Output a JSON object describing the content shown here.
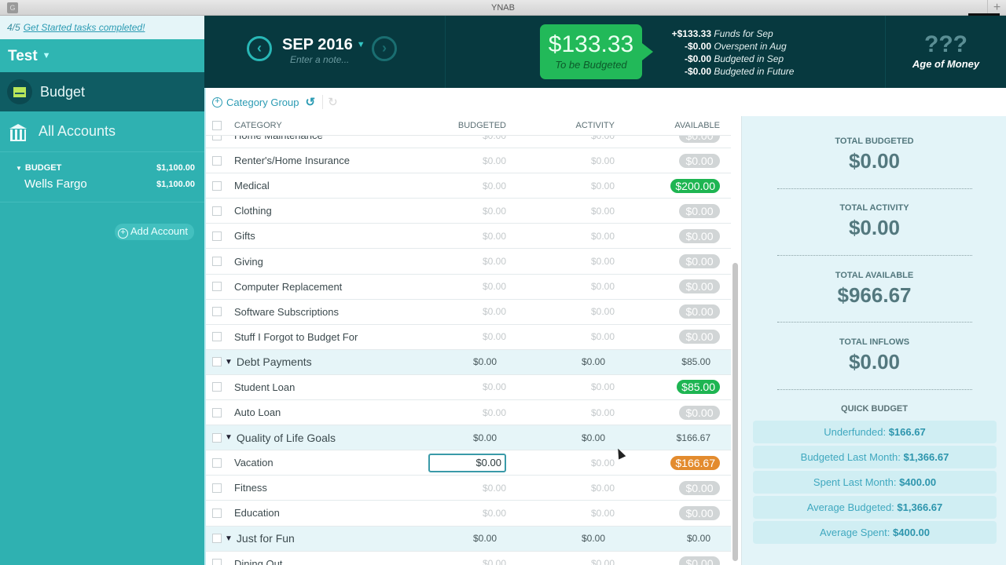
{
  "window": {
    "title": "YNAB"
  },
  "sidebar": {
    "get_started": {
      "count": "4/5",
      "link": "Get Started tasks completed!"
    },
    "budget_name": "Test",
    "nav": [
      {
        "label": "Budget",
        "icon": "envelope-icon"
      },
      {
        "label": "All Accounts",
        "icon": "bank-icon"
      }
    ],
    "account_group": {
      "label": "BUDGET",
      "total": "$1,100.00"
    },
    "accounts": [
      {
        "name": "Wells Fargo",
        "balance": "$1,100.00"
      }
    ],
    "add_account": "Add Account"
  },
  "header": {
    "month": "SEP 2016",
    "note_placeholder": "Enter a note...",
    "to_be_budgeted": {
      "amount": "$133.33",
      "label": "To be Budgeted",
      "color": "#22b959"
    },
    "breakdown": [
      {
        "value": "+$133.33",
        "label": "Funds for Sep"
      },
      {
        "value": "-$0.00",
        "label": "Overspent in Aug"
      },
      {
        "value": "-$0.00",
        "label": "Budgeted in Sep"
      },
      {
        "value": "-$0.00",
        "label": "Budgeted in Future"
      }
    ],
    "age_of_money": {
      "value": "???",
      "label": "Age of Money"
    }
  },
  "toolbar": {
    "category_group": "Category Group"
  },
  "table": {
    "columns": [
      "CATEGORY",
      "BUDGETED",
      "ACTIVITY",
      "AVAILABLE"
    ],
    "partial_row": {
      "name": "Home Maintenance",
      "budgeted": "$0.00",
      "activity": "$0.00",
      "available": "$0.00"
    },
    "rows": [
      {
        "type": "cat",
        "name": "Renter's/Home Insurance",
        "budgeted": "$0.00",
        "activity": "$0.00",
        "available": "$0.00",
        "status": "zero"
      },
      {
        "type": "cat",
        "name": "Medical",
        "budgeted": "$0.00",
        "activity": "$0.00",
        "available": "$200.00",
        "status": "green"
      },
      {
        "type": "cat",
        "name": "Clothing",
        "budgeted": "$0.00",
        "activity": "$0.00",
        "available": "$0.00",
        "status": "zero"
      },
      {
        "type": "cat",
        "name": "Gifts",
        "budgeted": "$0.00",
        "activity": "$0.00",
        "available": "$0.00",
        "status": "zero"
      },
      {
        "type": "cat",
        "name": "Giving",
        "budgeted": "$0.00",
        "activity": "$0.00",
        "available": "$0.00",
        "status": "zero"
      },
      {
        "type": "cat",
        "name": "Computer Replacement",
        "budgeted": "$0.00",
        "activity": "$0.00",
        "available": "$0.00",
        "status": "zero"
      },
      {
        "type": "cat",
        "name": "Software Subscriptions",
        "budgeted": "$0.00",
        "activity": "$0.00",
        "available": "$0.00",
        "status": "zero"
      },
      {
        "type": "cat",
        "name": "Stuff I Forgot to Budget For",
        "budgeted": "$0.00",
        "activity": "$0.00",
        "available": "$0.00",
        "status": "zero"
      },
      {
        "type": "group",
        "name": "Debt Payments",
        "budgeted": "$0.00",
        "activity": "$0.00",
        "available": "$85.00"
      },
      {
        "type": "cat",
        "name": "Student Loan",
        "budgeted": "$0.00",
        "activity": "$0.00",
        "available": "$85.00",
        "status": "green"
      },
      {
        "type": "cat",
        "name": "Auto Loan",
        "budgeted": "$0.00",
        "activity": "$0.00",
        "available": "$0.00",
        "status": "zero"
      },
      {
        "type": "group",
        "name": "Quality of Life Goals",
        "budgeted": "$0.00",
        "activity": "$0.00",
        "available": "$166.67"
      },
      {
        "type": "cat",
        "name": "Vacation",
        "budgeted": "$0.00",
        "activity": "$0.00",
        "available": "$166.67",
        "status": "orange",
        "editing": true
      },
      {
        "type": "cat",
        "name": "Fitness",
        "budgeted": "$0.00",
        "activity": "$0.00",
        "available": "$0.00",
        "status": "zero"
      },
      {
        "type": "cat",
        "name": "Education",
        "budgeted": "$0.00",
        "activity": "$0.00",
        "available": "$0.00",
        "status": "zero"
      },
      {
        "type": "group",
        "name": "Just for Fun",
        "budgeted": "$0.00",
        "activity": "$0.00",
        "available": "$0.00"
      },
      {
        "type": "cat",
        "name": "Dining Out",
        "budgeted": "$0.00",
        "activity": "$0.00",
        "available": "$0.00",
        "status": "zero"
      }
    ]
  },
  "inspector": {
    "totals": [
      {
        "label": "TOTAL BUDGETED",
        "value": "$0.00"
      },
      {
        "label": "TOTAL ACTIVITY",
        "value": "$0.00"
      },
      {
        "label": "TOTAL AVAILABLE",
        "value": "$966.67"
      },
      {
        "label": "TOTAL INFLOWS",
        "value": "$0.00"
      }
    ],
    "quick_budget_title": "QUICK BUDGET",
    "quick_budget": [
      {
        "label": "Underfunded:",
        "value": "$166.67"
      },
      {
        "label": "Budgeted Last Month:",
        "value": "$1,366.67"
      },
      {
        "label": "Spent Last Month:",
        "value": "$400.00"
      },
      {
        "label": "Average Budgeted:",
        "value": "$1,366.67"
      },
      {
        "label": "Average Spent:",
        "value": "$400.00"
      }
    ]
  }
}
